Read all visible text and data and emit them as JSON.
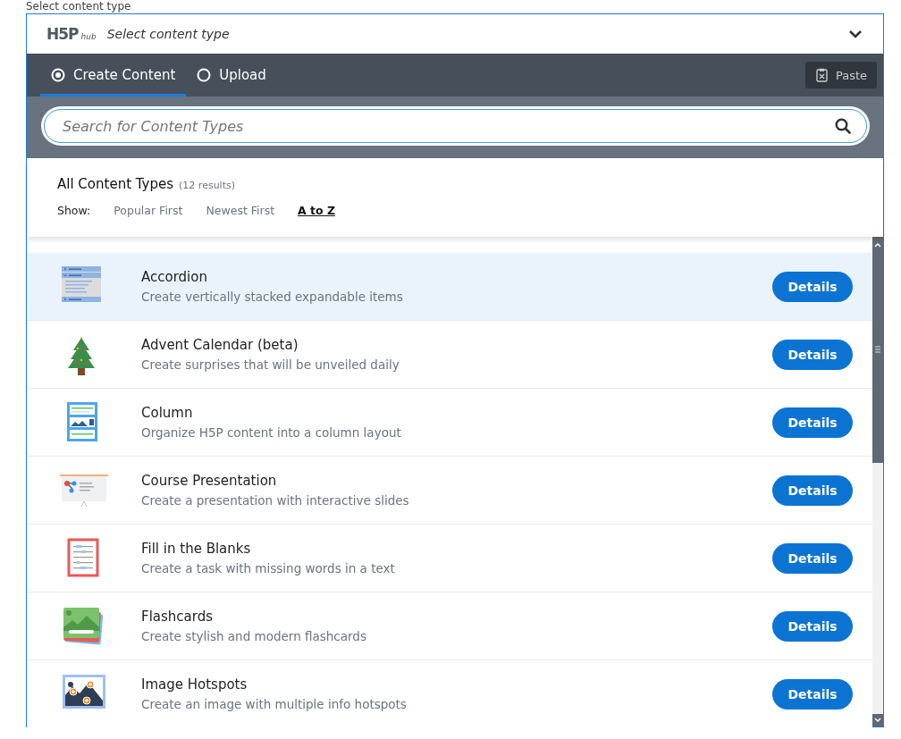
{
  "page_label": "Select content type",
  "header": {
    "logo": "H5P",
    "logo_sub": "hub",
    "title": "Select content type",
    "expanded": true
  },
  "tabs": [
    {
      "label": "Create Content",
      "selected": true
    },
    {
      "label": "Upload",
      "selected": false
    }
  ],
  "paste_button": "Paste",
  "search": {
    "placeholder": "Search for Content Types"
  },
  "results": {
    "heading": "All Content Types",
    "count": "(12 results)"
  },
  "sort": {
    "label": "Show:",
    "options": [
      {
        "label": "Popular First",
        "selected": false
      },
      {
        "label": "Newest First",
        "selected": false
      },
      {
        "label": "A to Z",
        "selected": true
      }
    ]
  },
  "content_types": [
    {
      "title": "Accordion",
      "description": "Create vertically stacked expandable items",
      "button": "Details",
      "selected": true
    },
    {
      "title": "Advent Calendar (beta)",
      "description": "Create surprises that will be unveiled daily",
      "button": "Details",
      "selected": false
    },
    {
      "title": "Column",
      "description": "Organize H5P content into a column layout",
      "button": "Details",
      "selected": false
    },
    {
      "title": "Course Presentation",
      "description": "Create a presentation with interactive slides",
      "button": "Details",
      "selected": false
    },
    {
      "title": "Fill in the Blanks",
      "description": "Create a task with missing words in a text",
      "button": "Details",
      "selected": false
    },
    {
      "title": "Flashcards",
      "description": "Create stylish and modern flashcards",
      "button": "Details",
      "selected": false
    },
    {
      "title": "Image Hotspots",
      "description": "Create an image with multiple info hotspots",
      "button": "Details",
      "selected": false
    }
  ]
}
